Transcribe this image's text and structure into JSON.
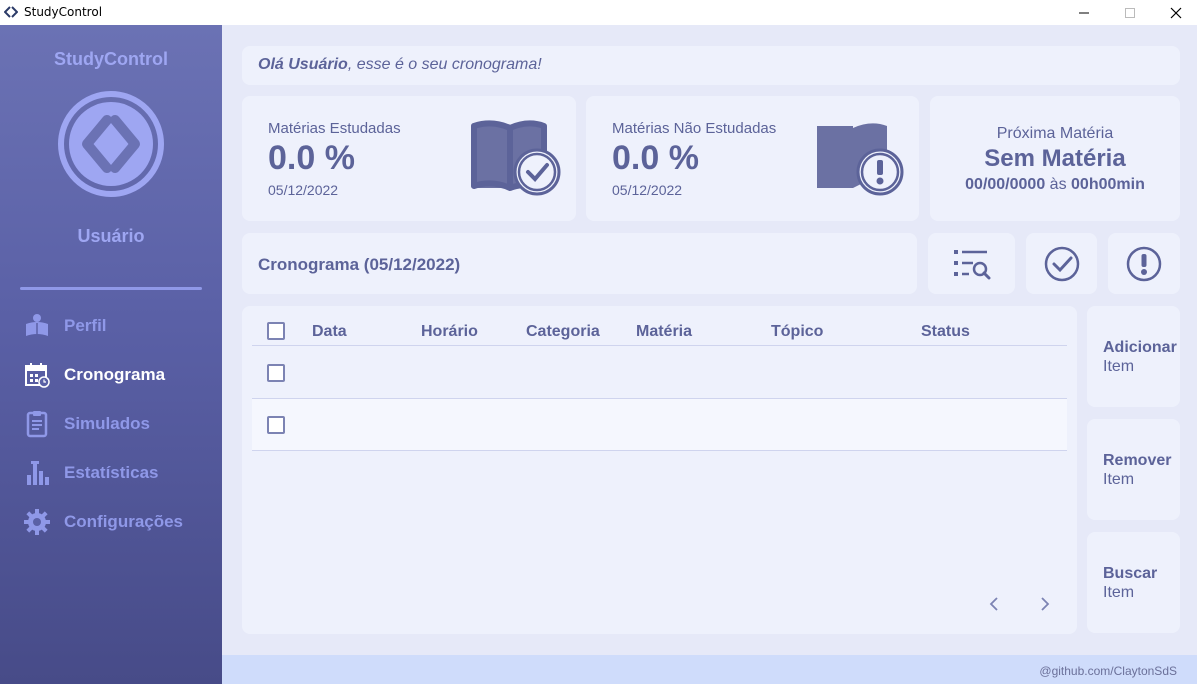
{
  "window": {
    "title": "StudyControl"
  },
  "sidebar": {
    "brand": "StudyControl",
    "user": "Usuário",
    "items": [
      {
        "label": "Perfil",
        "icon": "reader-icon",
        "active": false
      },
      {
        "label": "Cronograma",
        "icon": "calendar-icon",
        "active": true
      },
      {
        "label": "Simulados",
        "icon": "clipboard-icon",
        "active": false
      },
      {
        "label": "Estatísticas",
        "icon": "bar-chart-icon",
        "active": false
      },
      {
        "label": "Configurações",
        "icon": "gear-icon",
        "active": false
      }
    ]
  },
  "greeting": {
    "name": "Olá Usuário",
    "rest": ", esse é o seu cronograma!"
  },
  "stats": {
    "studied": {
      "label": "Matérias Estudadas",
      "value": "0.0 %",
      "date": "05/12/2022"
    },
    "not_studied": {
      "label": "Matérias Não Estudadas",
      "value": "0.0 %",
      "date": "05/12/2022"
    },
    "next": {
      "label": "Próxima Matéria",
      "value": "Sem Matéria",
      "date": "00/00/0000",
      "connector": "às",
      "time": "00h00min"
    }
  },
  "schedule": {
    "title": "Cronograma (05/12/2022)",
    "columns": [
      "Data",
      "Horário",
      "Categoria",
      "Matéria",
      "Tópico",
      "Status"
    ]
  },
  "actions": [
    {
      "main": "Adicionar",
      "sub": "Item"
    },
    {
      "main": "Remover",
      "sub": "Item"
    },
    {
      "main": "Buscar",
      "sub": "Item"
    }
  ],
  "footer": {
    "credit": "@github.com/ClaytonSdS"
  },
  "colors": {
    "accent": "#5c6399",
    "sidebar_text": "#8f98e8",
    "card_bg": "#eef1fc"
  }
}
